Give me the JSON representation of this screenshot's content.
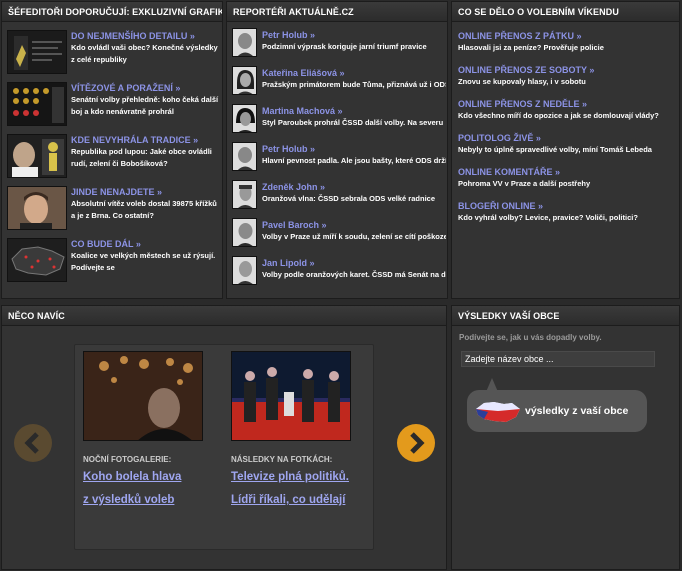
{
  "panels": {
    "sefeditori": {
      "title": "ŠÉFEDITOŘI DOPORUČUJÍ: EXKLUZIVNÍ GRAFIKY",
      "items": [
        {
          "link": "DO NEJMENŠÍHO DETAILU »",
          "desc": "Kdo ovládl vaši obec? Konečné výsledky z celé republiky"
        },
        {
          "link": "VÍTĚZOVÉ A PORAŽENÍ »",
          "desc": "Senátní volby přehledně: koho čeká další boj a kdo nenávratně prohrál"
        },
        {
          "link": "KDE NEVYHRÁLA TRADICE »",
          "desc": "Republika pod lupou: Jaké obce ovládli rudí, zelení či Bobošíková?"
        },
        {
          "link": "JINDE NENAJDETE »",
          "desc": "Absolutní vítěz voleb dostal 39875 křížků a je z Brna. Co ostatní?"
        },
        {
          "link": "CO BUDE DÁL »",
          "desc": "Koalice ve velkých městech se už rýsují. Podívejte se"
        }
      ]
    },
    "reporteri": {
      "title": "REPORTÉŘI AKTUÁLNĚ.CZ",
      "items": [
        {
          "link": "Petr Holub »",
          "desc": "Podzimní výprask koriguje jarní triumf pravice"
        },
        {
          "link": "Kateřina Eliášová »",
          "desc": "Pražským primátorem bude Tůma, přiznává už i ODS"
        },
        {
          "link": "Martina Machová »",
          "desc": "Styl Paroubek prohrál ČSSD další volby. Na severu"
        },
        {
          "link": "Petr Holub »",
          "desc": "Hlavní pevnost padla. Ale jsou bašty, které ODS drží"
        },
        {
          "link": "Zdeněk John »",
          "desc": "Oranžová vlna: ČSSD sebrala ODS velké radnice"
        },
        {
          "link": "Pavel Baroch »",
          "desc": "Volby v Praze už míří k soudu, zelení se cítí poškozeni"
        },
        {
          "link": "Jan Lipold »",
          "desc": "Volby podle oranžových karet. ČSSD má Senát na dosah"
        }
      ]
    },
    "vikend": {
      "title": "CO SE DĚLO O VOLEBNÍM VÍKENDU",
      "items": [
        {
          "link": "ONLINE PŘENOS Z PÁTKU »",
          "desc": "Hlasovali jsi za peníze? Prověřuje policie"
        },
        {
          "link": "ONLINE PŘENOS ZE SOBOTY »",
          "desc": "Znovu se kupovaly hlasy, i v sobotu"
        },
        {
          "link": "ONLINE PŘENOS Z NEDĚLE »",
          "desc": "Kdo všechno míří do opozice a jak se domlouvají vlády?"
        },
        {
          "link": "POLITOLOG ŽIVĚ »",
          "desc": "Nebyly to úplně spravedlivé volby, míní Tomáš Lebeda"
        },
        {
          "link": "ONLINE KOMENTÁŘE »",
          "desc": "Pohroma VV v Praze a další postřehy"
        },
        {
          "link": "BLOGEŘI ONLINE »",
          "desc": "Kdo vyhrál volby? Levice, pravice? Voliči, politici?"
        }
      ]
    },
    "navic": {
      "title": "NĚCO NAVÍC",
      "slides": [
        {
          "caption": "NOČNÍ FOTOGALERIE:",
          "link1": "Koho bolela hlava",
          "link2": "z výsledků voleb"
        },
        {
          "caption": "NÁSLEDKY NA FOTKÁCH:",
          "link1": "Televize plná politiků.",
          "link2": "Lídři říkali, co udělají"
        }
      ]
    },
    "obce": {
      "title": "VÝSLEDKY VAŠÍ OBCE",
      "hint": "Podívejte se, jak u vás dopadly volby.",
      "placeholder": "Zadejte název obce ...",
      "button": "výsledky z vaší obce"
    }
  },
  "colors": {
    "link": "#8c93e6",
    "arrow_active": "#e39a1c",
    "arrow_inactive": "#5a4a30"
  }
}
